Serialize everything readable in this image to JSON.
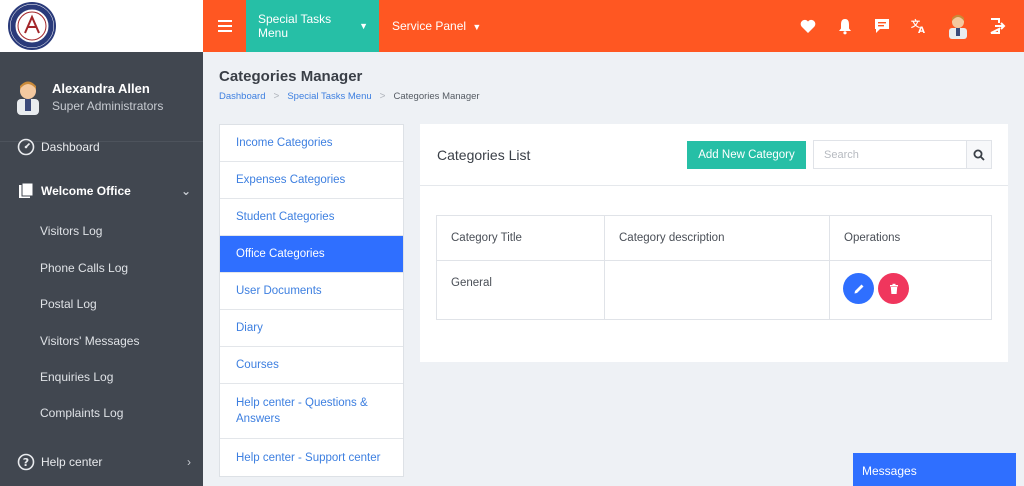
{
  "topbar": {
    "special_menu": "Special Tasks Menu",
    "service_panel": "Service Panel"
  },
  "profile": {
    "name": "Alexandra Allen",
    "role": "Super Administrators"
  },
  "sidebar": {
    "dashboard": "Dashboard",
    "welcome_office": "Welcome Office",
    "sub_items": [
      "Visitors Log",
      "Phone Calls Log",
      "Postal Log",
      "Visitors' Messages",
      "Enquiries Log",
      "Complaints Log"
    ],
    "help_center": "Help center"
  },
  "page": {
    "title": "Categories Manager",
    "breadcrumb": [
      "Dashboard",
      "Special Tasks Menu",
      "Categories Manager"
    ]
  },
  "category_menu": {
    "items": [
      "Income Categories",
      "Expenses Categories",
      "Student Categories",
      "Office Categories",
      "User Documents",
      "Diary",
      "Courses",
      "Help center - Questions & Answers",
      "Help center - Support center"
    ],
    "active_index": 3
  },
  "card": {
    "title": "Categories List",
    "add_button": "Add New Category",
    "search_placeholder": "Search"
  },
  "table": {
    "headers": [
      "Category Title",
      "Category description",
      "Operations"
    ],
    "rows": [
      {
        "title": "General",
        "description": ""
      }
    ]
  },
  "messages_tab": "Messages",
  "colors": {
    "topbar": "#ff5722",
    "accent_teal": "#26bfa6",
    "accent_blue": "#2f6fff",
    "danger": "#f0365d",
    "sidebar": "#414750"
  }
}
